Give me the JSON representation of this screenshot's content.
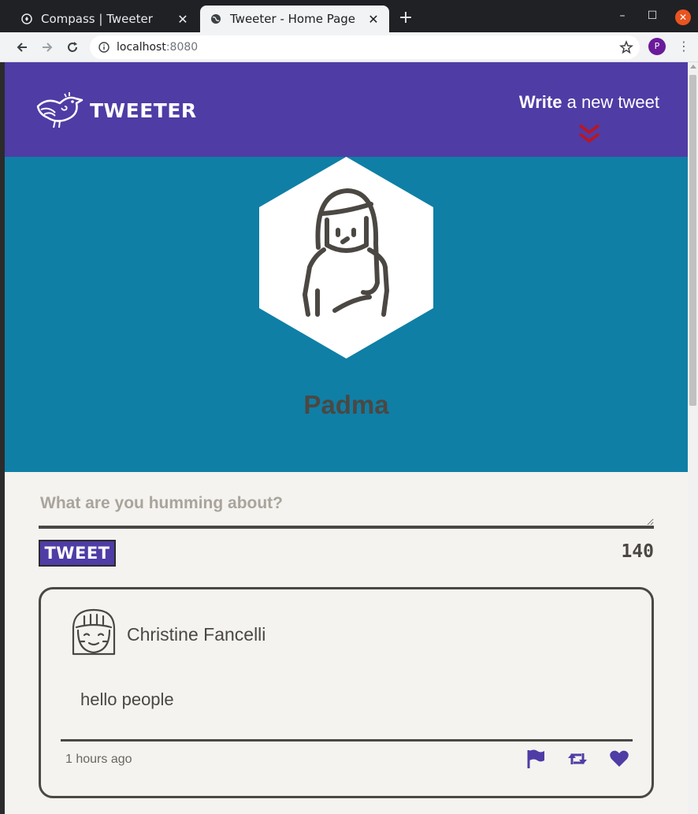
{
  "browser": {
    "tabs": [
      {
        "label": "Compass | Tweeter",
        "active": false
      },
      {
        "label": "Tweeter - Home Page",
        "active": true
      }
    ],
    "url_host": "localhost",
    "url_port": ":8080",
    "profile_initial": "P"
  },
  "nav": {
    "brand": "TWEETER",
    "compose_bold": "Write",
    "compose_rest": " a new tweet"
  },
  "profile": {
    "name": "Padma"
  },
  "composer": {
    "placeholder": "What are you humming about?",
    "button_label": "TWEET",
    "counter": "140"
  },
  "tweets": [
    {
      "author": "Christine Fancelli",
      "text": "hello people",
      "time": "1 hours ago"
    }
  ],
  "colors": {
    "nav": "#4f3ca5",
    "header": "#0f7fa6",
    "page": "#f4f3ef",
    "text": "#4b4843",
    "accent_chevron": "#c0141c"
  }
}
